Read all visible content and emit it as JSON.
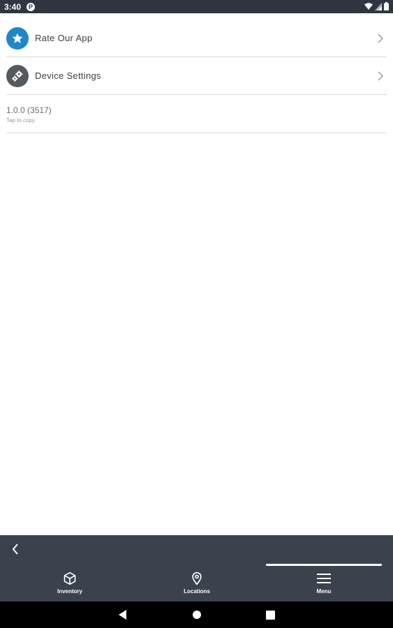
{
  "status_bar": {
    "time": "3:40",
    "app_icon_letter": "P"
  },
  "menu": {
    "items": [
      {
        "label": "Rate Our App",
        "icon": "star-icon",
        "icon_bg": "#1f86c7"
      },
      {
        "label": "Device Settings",
        "icon": "gears-icon",
        "icon_bg": "#555a60"
      }
    ],
    "version": "1.0.0 (3517)",
    "version_hint": "Tap to copy."
  },
  "tabs": [
    {
      "label": "Inventory",
      "icon": "box-icon"
    },
    {
      "label": "Locations",
      "icon": "location-pin-icon"
    },
    {
      "label": "Menu",
      "icon": "hamburger-menu-icon",
      "selected": true
    }
  ],
  "colors": {
    "status_bar": "#2f3641",
    "bottom_bar": "#3a424e",
    "accent_blue": "#1f86c7"
  }
}
